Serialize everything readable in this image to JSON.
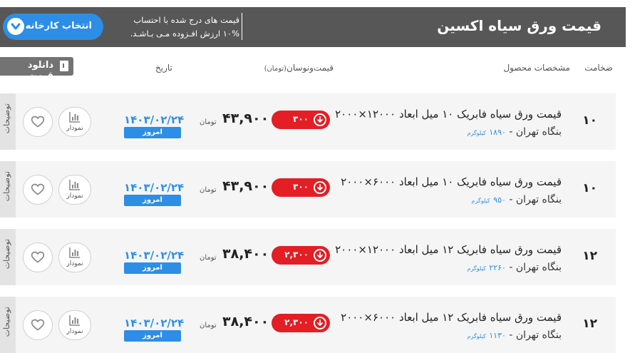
{
  "header": {
    "title": "قیمت ورق سیاه اکسین",
    "note_line1": "قیمت های درج شده با احتساب",
    "note_line2": "۱۰% ارزش افـزوده مـی بـاشـد.",
    "factory_button": "انتخاب کارخانه"
  },
  "table": {
    "col_thickness": "ضخامت",
    "col_specs": "مشخصات محصول",
    "col_price": "قیمت‌ونوسان",
    "col_price_unit": "(تومان)",
    "col_date": "تاریخ",
    "download_button": "دانلود قیمت"
  },
  "rows": [
    {
      "thickness": "۱۰",
      "name": "قیمت ورق سیاه فابریک ۱۰ میل ابعاد ۱۲۰۰۰×۲۰۰۰",
      "warehouse": "بنگاه تهران - ",
      "weight": "۱۸۹۰",
      "weight_unit": "کیلوگرم",
      "change": "۳۰۰",
      "price": "۴۳,۹۰۰",
      "unit": "تومان",
      "date": "۱۴۰۳/۰۲/۲۴",
      "today": "امروز",
      "chart_label": "نمودار",
      "side_tab": "توضیحات"
    },
    {
      "thickness": "۱۰",
      "name": "قیمت ورق سیاه فابریک ۱۰ میل ابعاد ۶۰۰۰×۲۰۰۰",
      "warehouse": "بنگاه تهران - ",
      "weight": "۹۵۰",
      "weight_unit": "کیلوگرم",
      "change": "۳۰۰",
      "price": "۴۳,۹۰۰",
      "unit": "تومان",
      "date": "۱۴۰۳/۰۲/۲۴",
      "today": "امروز",
      "chart_label": "نمودار",
      "side_tab": "توضیحات"
    },
    {
      "thickness": "۱۲",
      "name": "قیمت ورق سیاه فابریک ۱۲ میل ابعاد ۱۲۰۰۰×۲۰۰۰",
      "warehouse": "بنگاه تهران - ",
      "weight": "۲۲۶۰",
      "weight_unit": "کیلوگرم",
      "change": "۲,۳۰۰",
      "price": "۳۸,۴۰۰",
      "unit": "تومان",
      "date": "۱۴۰۳/۰۲/۲۴",
      "today": "امروز",
      "chart_label": "نمودار",
      "side_tab": "توضیحات"
    },
    {
      "thickness": "۱۲",
      "name": "قیمت ورق سیاه فابریک ۱۲ میل ابعاد ۶۰۰۰×۲۰۰۰",
      "warehouse": "بنگاه تهران - ",
      "weight": "۱۱۳۰",
      "weight_unit": "کیلوگرم",
      "change": "۲,۳۰۰",
      "price": "۳۸,۴۰۰",
      "unit": "تومان",
      "date": "۱۴۰۳/۰۲/۲۴",
      "today": "امروز",
      "chart_label": "نمودار",
      "side_tab": "توضیحات"
    }
  ],
  "colors": {
    "header_bg": "#575757",
    "accent_blue": "#2e8ee6",
    "change_red": "#e31e24"
  }
}
